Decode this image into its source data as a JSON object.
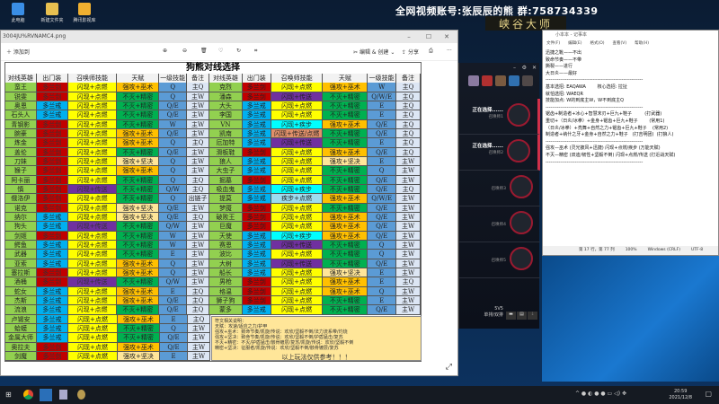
{
  "desktop": {
    "icons": [
      "此电脑",
      "新建文件夹",
      "腾讯影视库"
    ],
    "banner": "全网视频账号:张辰辰的熊  群:758734339",
    "brand": "峡谷大师"
  },
  "viewer": {
    "title": "3004JU%RVNAMC4.png",
    "add_label": "添加到",
    "edit_label": "编辑 & 创建",
    "share_label": "分享"
  },
  "table": {
    "title": "狗熊对线选择",
    "headers": [
      "对线英雄",
      "出门装",
      "召唤师技能",
      "天赋",
      "一级技能",
      "备注"
    ],
    "left": [
      [
        "蛮王",
        "多兰剑",
        "闪现+点燃",
        "强攻+巫术",
        "Q",
        "主Q"
      ],
      [
        "锐雯",
        "多兰剑",
        "闪现+点燃",
        "不灭+精密",
        "Q",
        "主W"
      ],
      [
        "奥恩",
        "多兰戒",
        "闪现+点燃",
        "不灭+精密",
        "Q/E",
        "主W"
      ],
      [
        "石头人",
        "多兰戒",
        "闪现+点燃",
        "不灭+精密",
        "Q/E",
        "主W"
      ],
      [
        "青钢影",
        "多兰剑",
        "闪现+点燃",
        "不灭+精密",
        "W",
        "主W"
      ],
      [
        "腕豪",
        "多兰剑",
        "闪现+点燃",
        "强攻+巫术",
        "Q/E",
        "主W"
      ],
      [
        "炼金",
        "多兰剑",
        "闪现+点燃",
        "强攻+巫术",
        "Q",
        "主Q"
      ],
      [
        "盖伦",
        "多兰剑",
        "闪现+点燃",
        "不灭+精密",
        "Q/E",
        "主W"
      ],
      [
        "刀妹",
        "多兰剑",
        "闪现+点燃",
        "强攻+坚决",
        "Q",
        "主W"
      ],
      [
        "猴子",
        "多兰剑",
        "闪现+点燃",
        "强攻+巫术",
        "Q",
        "主W"
      ],
      [
        "阿卡丽",
        "多兰剑",
        "闪现+点燃",
        "不灭+精密",
        "Q",
        "主Q"
      ],
      [
        "慎",
        "多兰剑",
        "闪现+传送",
        "不灭+精密",
        "Q/W",
        "主Q"
      ],
      [
        "俄洛伊",
        "多兰剑",
        "闪现+点燃",
        "不灭+精密",
        "Q",
        "出链子"
      ],
      [
        "诺克",
        "多兰剑",
        "闪现+点燃",
        "强攻+坚决",
        "Q/E",
        "主W"
      ],
      [
        "纳尔",
        "多兰戒",
        "闪现+点燃",
        "强攻+坚决",
        "Q/E",
        "主Q"
      ],
      [
        "狗头",
        "多兰戒",
        "闪现+传送",
        "不灭+精密",
        "Q/W",
        "主W"
      ],
      [
        "剑姬",
        "多兰剑",
        "闪现+点燃",
        "不灭+精密",
        "W",
        "主W"
      ],
      [
        "鳄鱼",
        "多兰戒",
        "闪现+点燃",
        "不灭+精密",
        "W",
        "主W"
      ],
      [
        "武器",
        "多兰戒",
        "闪现+点燃",
        "不灭+精密",
        "E",
        "主W"
      ],
      [
        "亚索",
        "多兰戒",
        "闪现+点燃",
        "强攻+巫术",
        "Q",
        "主W"
      ],
      [
        "塞拉斯",
        "多兰剑",
        "闪现+点燃",
        "强攻+巫术",
        "Q",
        "主W"
      ],
      [
        "酒桶",
        "多兰剑",
        "闪现+传送",
        "不灭+精密",
        "Q/W",
        "主W"
      ],
      [
        "蛇女",
        "多兰戒",
        "闪现+点燃",
        "强攻+巫术",
        "E",
        "主Q"
      ],
      [
        "杰斯",
        "多兰戒",
        "闪现+点燃",
        "强攻+巫术",
        "Q/E",
        "主Q"
      ],
      [
        "流浪",
        "多兰戒",
        "闪现+点燃",
        "不灭+精密",
        "Q/E",
        "主Q"
      ],
      [
        "卢锡安",
        "多兰戒",
        "闪现+点燃",
        "强攻+巫术",
        "E",
        "主Q"
      ],
      [
        "蛤蟆",
        "多兰戒",
        "闪现+点燃",
        "不灭+精密",
        "Q",
        "主W"
      ],
      [
        "金属大师",
        "多兰戒",
        "闪现+点燃",
        "不灭+精密",
        "Q/E",
        "主W"
      ],
      [
        "奥拉夫",
        "多兰剑",
        "闪现+点燃",
        "强攻+巫术",
        "Q/E",
        "主W"
      ],
      [
        "剑魔",
        "多兰剑",
        "闪现+点燃",
        "强攻+坚决",
        "E",
        "主W"
      ]
    ],
    "right": [
      [
        "克烈",
        "多兰剑",
        "闪现+点燃",
        "强攻+巫术",
        "W",
        "主Q"
      ],
      [
        "潘森",
        "多兰剑",
        "闪现+传送",
        "不灭+精密",
        "Q/W/E",
        "主Q"
      ],
      [
        "大头",
        "多兰戒",
        "闪现+点燃",
        "不灭+精密",
        "E",
        "主Q"
      ],
      [
        "李国",
        "多兰戒",
        "闪现+点燃",
        "不灭+精密",
        "E",
        "主Q"
      ],
      [
        "VN",
        "多兰戒",
        "闪现+疾步",
        "强攻+巫术",
        "Q/E",
        "主Q"
      ],
      [
        "凯南",
        "多兰戒",
        "闪现+传送/点燃",
        "不灭+精密",
        "Q/E",
        "主Q"
      ],
      [
        "厄加特",
        "多兰戒",
        "闪现+传送",
        "不灭+精密",
        "E",
        "主Q"
      ],
      [
        "滑板鞋",
        "多兰剑",
        "闪现+点燃",
        "强攻+巫术",
        "Q/E",
        "主Q"
      ],
      [
        "狼人",
        "多兰戒",
        "闪现+点燃",
        "强攻+坚决",
        "E",
        "主W"
      ],
      [
        "大虫子",
        "多兰戒",
        "闪现+点燃",
        "不灭+精密",
        "Q",
        "主W"
      ],
      [
        "掘墓",
        "多兰剑",
        "闪现+点燃",
        "不灭+精密",
        "Q/E",
        "主W"
      ],
      [
        "吸血鬼",
        "多兰戒",
        "闪现+疾步",
        "不灭+精密",
        "Q/E",
        "主Q"
      ],
      [
        "提莫",
        "多兰戒",
        "疾步+点燃",
        "强攻+巫术",
        "Q/W/E",
        "主W"
      ],
      [
        "梦魇",
        "多兰剑",
        "闪现+点燃",
        "不灭+精密",
        "Q/E",
        "主W"
      ],
      [
        "破败王",
        "多兰剑",
        "闪现+点燃",
        "强攻+巫术",
        "Q/E",
        "主W"
      ],
      [
        "巨魔",
        "多兰剑",
        "闪现+点燃",
        "强攻+巫术",
        "Q/E",
        "主W"
      ],
      [
        "天使",
        "多兰戒",
        "闪现+疾步",
        "强攻+巫术",
        "Q/E",
        "主W"
      ],
      [
        "赛恩",
        "多兰戒",
        "闪现+传送",
        "不灭+精密",
        "Q",
        "主W"
      ],
      [
        "波比",
        "多兰戒",
        "闪现+点燃",
        "不灭+精密",
        "Q",
        "主W"
      ],
      [
        "大树",
        "多兰戒",
        "闪现+传送",
        "不灭+精密",
        "Q/E",
        "主W"
      ],
      [
        "船长",
        "多兰戒",
        "闪现+点燃",
        "强攻+坚决",
        "E",
        "主W"
      ],
      [
        "男枪",
        "多兰剑",
        "闪现+点燃",
        "强攻+巫术",
        "E",
        "主Q"
      ],
      [
        "格温",
        "多兰剑",
        "闪现+点燃",
        "强攻+巫术",
        "Q",
        "主W"
      ],
      [
        "狮子狗",
        "多兰剑",
        "闪现+点燃",
        "不灭+精密",
        "E",
        "主W"
      ],
      [
        "蒙多",
        "多兰戒",
        "闪现+点燃",
        "不灭+精密",
        "Q/E",
        "主W"
      ]
    ],
    "notes": [
      "符文相关说明：",
      "天赋：攻速/适应之力/护甲",
      "强攻+巫术：致命节奏/凯旋/传说：欢欣/坚毅不倒/法力流系带/灼烧",
      "强攻+坚决：致命节奏/凯旋/传说：欢欣/坚毅不倒/护盾猛击/复苏",
      "不灭+精密：不灭/护盾猛击/骸骨镀层/复苏/凯旋/传说：欢欣/坚毅不倒",
      "精密+坚决：征服者/凯旋/传说：欢欣/坚毅不倒/骸骨镀层/复苏"
    ],
    "notes_end": "以上玩法仅供参考！！！"
  },
  "colors": {
    "name": "#92d050",
    "note": "#dce6f4",
    "skill": "#5b9bd5",
    "item": {
      "多兰剑": "#c00000",
      "多兰戒": "#00b0f0"
    },
    "spell": {
      "闪现+点燃": "#ffff00",
      "闪现+传送": "#7030a0",
      "闪现+疾步": "#00ffff",
      "疾步+点燃": "#9ddcf0",
      "闪现+传送/点燃": "#e0906a"
    },
    "talent": {
      "强攻+巫术": "#ffc000",
      "不灭+精密": "#00b050",
      "强攻+坚决": "#ffe699"
    }
  },
  "client": {
    "slots": [
      {
        "status": "正在选择......",
        "name": "召唤师1"
      },
      {
        "status": "正在选择......",
        "name": "召唤师2"
      },
      {
        "status": "",
        "name": "召唤师3"
      },
      {
        "status": "",
        "name": "召唤师4"
      },
      {
        "status": "",
        "name": "召唤师5"
      }
    ],
    "mode": "5V5",
    "queue": "单排/双排"
  },
  "notepad": {
    "title": "小本本 - 记事本",
    "menu": [
      "文件(F)",
      "编辑(E)",
      "格式(O)",
      "查看(V)",
      "帮助(H)"
    ],
    "lines": [
      "迅捷之靴——不出",
      "致命节奏——不带",
      "撕裂——进行",
      "大日炎——最好",
      "------------------------------------------------------------",
      "基本选招: EAQAWA        核心选招: 拉扯",
      "就怕选招: WAEQR",
      "技能加点: W的到底主W，W不到底主Q",
      "------------------------------------------------------------",
      "锯齿+制造者+冰心+智慧末刃+巨九+鞋子         (打武器)",
      "重切+（日炎/冰拳）+金身+锯齿+巨九+鞋子        (常用1)",
      "（日炎/冰拳）+亮舞+自然之力+锯齿+巨九+鞋子    (常用2)",
      "制造者+纳什之牙+金身+自然之力+鞋子   (打吉明团)  (打狼人)",
      "------------------------------------------------------------",
      "强攻—巫术 (灵光披风+迅捷) 闪现+点燃/疾步 (万能天赋)",
      "不灭—精密 (双迪/韧性+坚毅不倒) 闪现+点燃/传送 (打近战天赋)",
      "------------------------------------------------------------"
    ],
    "status": {
      "position": "第 17 行，第 77 列",
      "zoom": "100%",
      "eol": "Windows (CRLF)",
      "encoding": "UTF-8"
    }
  },
  "taskbar": {
    "time": "20:59",
    "date": "2021/12/8"
  }
}
